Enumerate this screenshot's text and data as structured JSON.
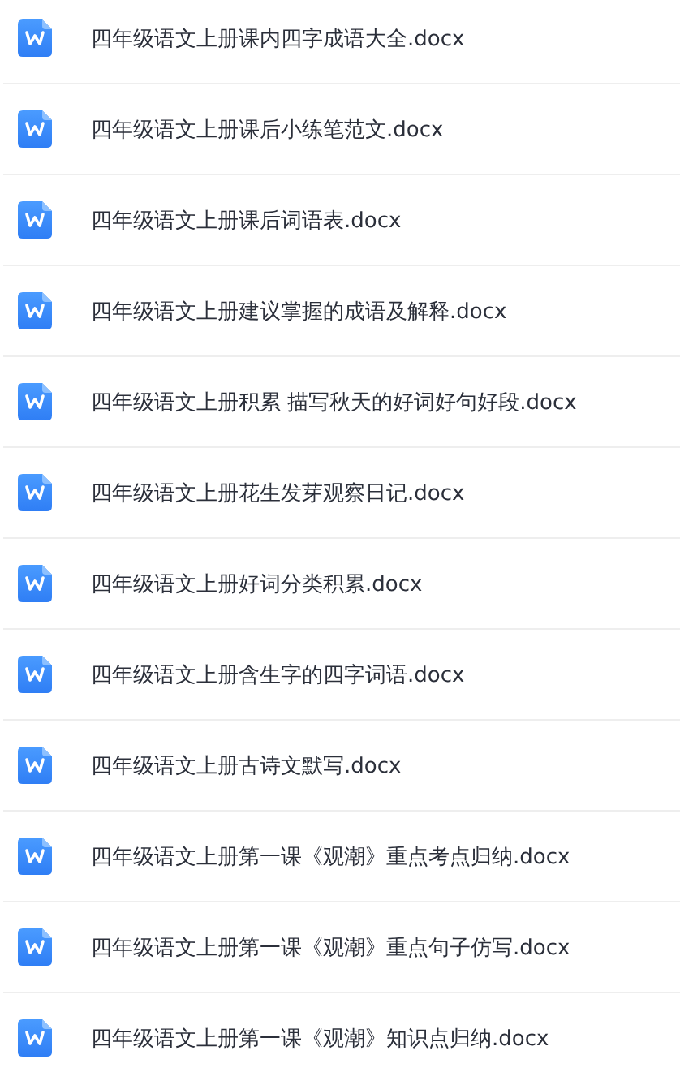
{
  "files": [
    {
      "name": "四年级语文上册课内四字成语大全.docx",
      "kind": "word"
    },
    {
      "name": "四年级语文上册课后小练笔范文.docx",
      "kind": "word"
    },
    {
      "name": "四年级语文上册课后词语表.docx",
      "kind": "word"
    },
    {
      "name": "四年级语文上册建议掌握的成语及解释.docx",
      "kind": "word"
    },
    {
      "name": "四年级语文上册积累 描写秋天的好词好句好段.docx",
      "kind": "word"
    },
    {
      "name": "四年级语文上册花生发芽观察日记.docx",
      "kind": "word"
    },
    {
      "name": "四年级语文上册好词分类积累.docx",
      "kind": "word"
    },
    {
      "name": "四年级语文上册含生字的四字词语.docx",
      "kind": "word"
    },
    {
      "name": "四年级语文上册古诗文默写.docx",
      "kind": "word"
    },
    {
      "name": "四年级语文上册第一课《观潮》重点考点归纳.docx",
      "kind": "word"
    },
    {
      "name": "四年级语文上册第一课《观潮》重点句子仿写.docx",
      "kind": "word"
    },
    {
      "name": "四年级语文上册第一课《观潮》知识点归纳.docx",
      "kind": "word"
    }
  ]
}
